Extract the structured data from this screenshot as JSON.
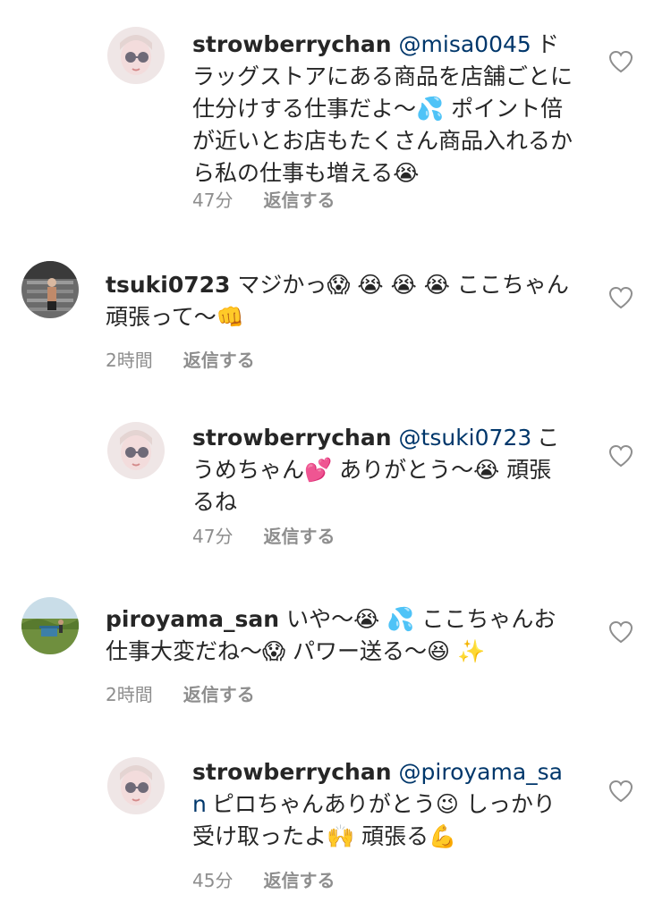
{
  "comments": [
    {
      "username": "strowberrychan",
      "mention": "@misa0045",
      "body": "ドラッグストアにある商品を店舗ごとに仕分けする仕事だよ〜💦 ポイント倍が近いとお店もたくさん商品入れるから私の仕事も増える😭",
      "time": "47分",
      "reply": "返信する"
    },
    {
      "username": "tsuki0723",
      "mention": "",
      "body": "マジかっ😱 😭 😭 😭 ここちゃん頑張って〜👊",
      "time": "2時間",
      "reply": "返信する"
    },
    {
      "username": "strowberrychan",
      "mention": "@tsuki0723",
      "body": "こうめちゃん💕 ありがとう〜😭 頑張るね",
      "time": "47分",
      "reply": "返信する"
    },
    {
      "username": "piroyama_san",
      "mention": "",
      "body": "いや〜😭 💦 ここちゃんお仕事大変だね〜😱 パワー送る〜😆 ✨",
      "time": "2時間",
      "reply": "返信する"
    },
    {
      "username": "strowberrychan",
      "mention": "@piroyama_san",
      "body": "ピロちゃんありがとう😉 しっかり受け取ったよ🙌 頑張る💪",
      "time": "45分",
      "reply": "返信する"
    }
  ],
  "icons": {
    "like": "heart-outline-icon"
  }
}
